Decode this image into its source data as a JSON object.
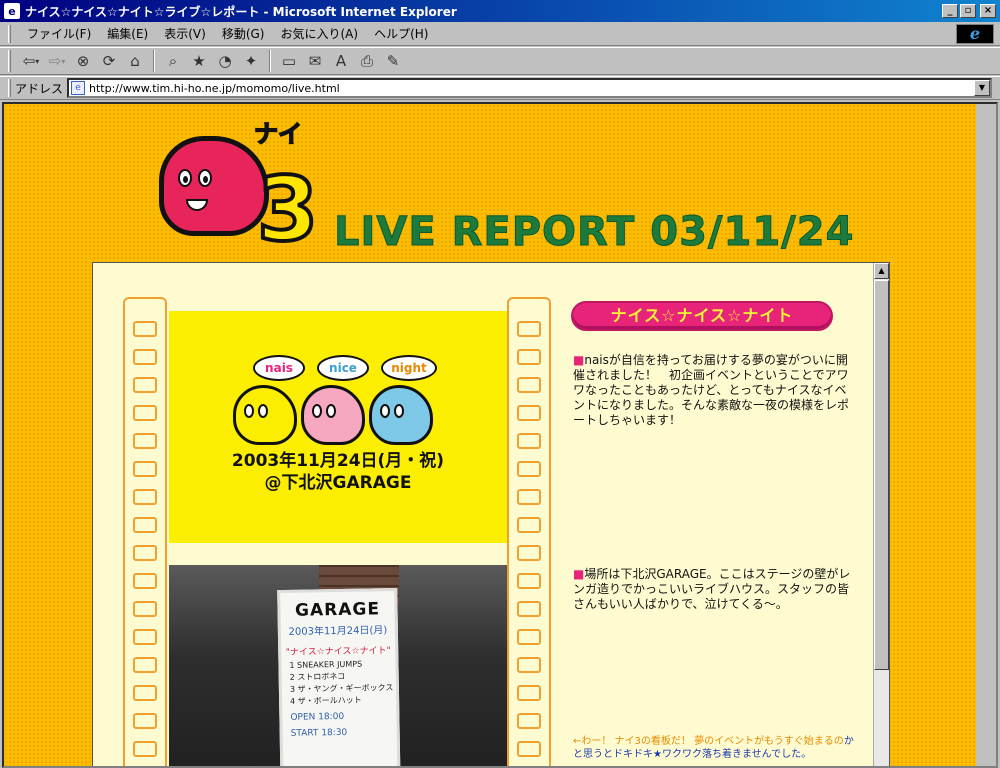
{
  "window": {
    "title": "ナイス☆ナイス☆ナイト☆ライブ☆レポート - Microsoft Internet Explorer",
    "app_icon": "e",
    "minimize": "_",
    "maximize": "▫",
    "close": "×"
  },
  "menu": {
    "items": [
      "ファイル(F)",
      "編集(E)",
      "表示(V)",
      "移動(G)",
      "お気に入り(A)",
      "ヘルプ(H)"
    ],
    "ie_logo": "e"
  },
  "toolbar": {
    "icons": [
      "back-icon",
      "forward-icon",
      "stop-icon",
      "refresh-icon",
      "home-icon",
      "search-icon",
      "favorites-icon",
      "history-icon",
      "channels-icon",
      "fullscreen-icon",
      "mail-icon",
      "font-icon",
      "print-icon",
      "edit-icon"
    ]
  },
  "address": {
    "label": "アドレス",
    "url": "http://www.tim.hi-ho.ne.jp/momomo/live.html"
  },
  "page": {
    "logo_nai": "ナイ",
    "logo_three": "3",
    "report_title": "LIVE REPORT  03/11/24",
    "event": {
      "bubble_1": "nais",
      "bubble_2": "nice",
      "bubble_3": "night",
      "date_line": "2003年11月24日(月・祝)",
      "venue_line": "@下北沢GARAGE"
    },
    "sign": {
      "title": "GARAGE",
      "date": "2003年11月24日(月)",
      "event": "\"ナイス☆ナイス☆ナイト\"",
      "lines": [
        "1 SNEAKER JUMPS",
        "2 ストロボネコ",
        "3 ザ・ヤング・ギーボックス",
        "4 ザ・ボールハット"
      ],
      "open": "OPEN 18:00",
      "start": "START 18:30"
    },
    "badge": "ナイス☆ナイス☆ナイト",
    "para_1": "naisが自信を持ってお届けする夢の宴がついに開催されました！　初企画イベントということでアワワなったこともあったけど、とってもナイスなイベントになりました。そんな素敵な一夜の模様をレポートしちゃいます！",
    "para_2": "場所は下北沢GARAGE。ここはステージの壁がレンガ造りでかっこいいライブハウス。スタッフの皆さんもいい人ばかりで、泣けてくる〜。",
    "para_3_orange": "←わー！ ナイ3の看板だ！ 夢のイベントがもうすぐ始まるの",
    "para_3_blue": "かと思うとドキドキ★ワクワク落ち着きませんでした。",
    "square": "■"
  },
  "colors": {
    "background": "#fbbf00",
    "title_green": "#1c7a3c",
    "accent_pink": "#e8247a",
    "frame_bg": "#fffbd0"
  }
}
